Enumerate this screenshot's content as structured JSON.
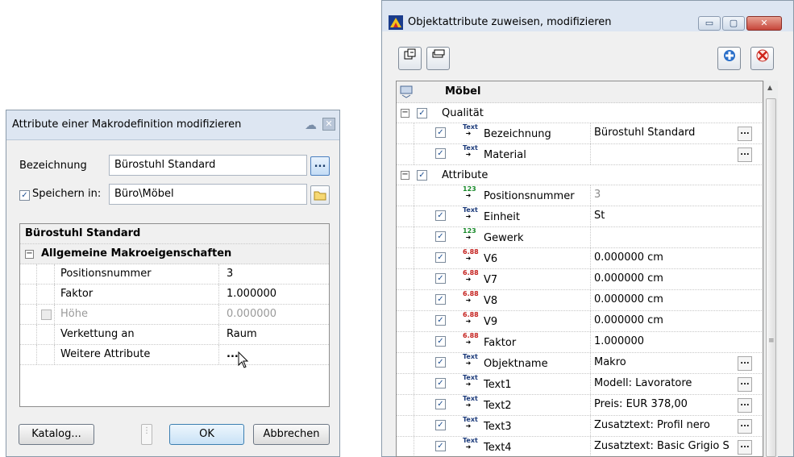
{
  "left_dialog": {
    "title": "Attribute einer Makrodefinition modifizieren",
    "bezeichnung_label": "Bezeichnung",
    "bezeichnung_value": "Bürostuhl Standard",
    "browse_label": "...",
    "speichern_label": "Speichern in:",
    "speichern_checked": true,
    "speichern_value": "Büro\\Möbel",
    "grid": {
      "header": "Bürostuhl Standard",
      "group": "Allgemeine Makroeigenschaften",
      "rows": [
        {
          "name": "Positionsnummer",
          "value": "3"
        },
        {
          "name": "Faktor",
          "value": "1.000000"
        },
        {
          "name": "Höhe",
          "value": "0.000000",
          "disabled": true
        },
        {
          "name": "Verkettung an",
          "value": "Raum"
        },
        {
          "name": "Weitere Attribute",
          "value": "..."
        }
      ]
    },
    "buttons": {
      "katalog": "Katalog...",
      "ok": "OK",
      "abbrechen": "Abbrechen"
    }
  },
  "right_dialog": {
    "title": "Objektattribute zuweisen, modifizieren",
    "window_buttons": {
      "minimize": "▭",
      "maximize": "▢",
      "close": "✕"
    },
    "tree": {
      "root": "Möbel",
      "groups": [
        {
          "label": "Qualität",
          "rows": [
            {
              "type": "Text",
              "name": "Bezeichnung",
              "value": "Bürostuhl Standard",
              "dots": true
            },
            {
              "type": "Text",
              "name": "Material",
              "value": "",
              "dots": true
            }
          ]
        },
        {
          "label": "Attribute",
          "rows": [
            {
              "type": "123",
              "name": "Positionsnummer",
              "value": "3",
              "no_checkbox": true
            },
            {
              "type": "Text",
              "name": "Einheit",
              "value": "St"
            },
            {
              "type": "123",
              "name": "Gewerk",
              "value": ""
            },
            {
              "type": "6.88",
              "name": "V6",
              "value": "0.000000 cm"
            },
            {
              "type": "6.88",
              "name": "V7",
              "value": "0.000000 cm"
            },
            {
              "type": "6.88",
              "name": "V8",
              "value": "0.000000 cm"
            },
            {
              "type": "6.88",
              "name": "V9",
              "value": "0.000000 cm"
            },
            {
              "type": "6.88",
              "name": "Faktor",
              "value": "1.000000"
            },
            {
              "type": "Text",
              "name": "Objektname",
              "value": "Makro",
              "dots": true
            },
            {
              "type": "Text",
              "name": "Text1",
              "value": "Modell: Lavoratore",
              "dots": true
            },
            {
              "type": "Text",
              "name": "Text2",
              "value": "Preis: EUR 378,00",
              "dots": true
            },
            {
              "type": "Text",
              "name": "Text3",
              "value": "Zusatztext: Profil nero",
              "dots": true
            },
            {
              "type": "Text",
              "name": "Text4",
              "value": "Zusatztext: Basic Grigio S",
              "dots": true
            }
          ]
        }
      ]
    }
  }
}
